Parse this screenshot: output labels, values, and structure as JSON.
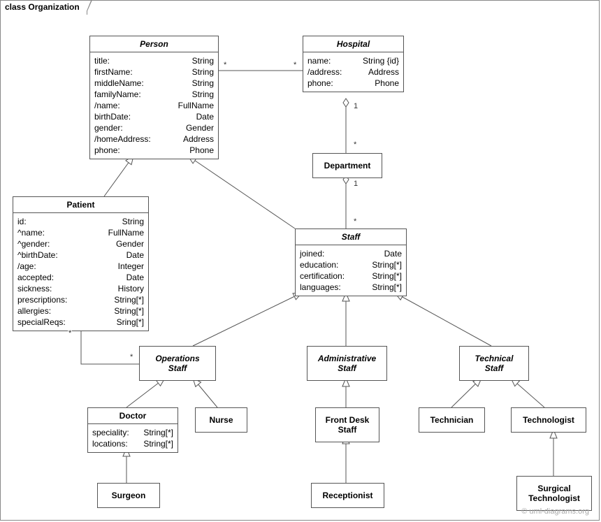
{
  "frame": {
    "title": "class Organization"
  },
  "classes": {
    "person": {
      "title": "Person",
      "attrs": [
        [
          "title:",
          "String"
        ],
        [
          "firstName:",
          "String"
        ],
        [
          "middleName:",
          "String"
        ],
        [
          "familyName:",
          "String"
        ],
        [
          "/name:",
          "FullName"
        ],
        [
          "birthDate:",
          "Date"
        ],
        [
          "gender:",
          "Gender"
        ],
        [
          "/homeAddress:",
          "Address"
        ],
        [
          "phone:",
          "Phone"
        ]
      ]
    },
    "hospital": {
      "title": "Hospital",
      "attrs": [
        [
          "name:",
          "String {id}"
        ],
        [
          "/address:",
          "Address"
        ],
        [
          "phone:",
          "Phone"
        ]
      ]
    },
    "department": {
      "title": "Department"
    },
    "patient": {
      "title": "Patient",
      "attrs": [
        [
          "id:",
          "String"
        ],
        [
          "^name:",
          "FullName"
        ],
        [
          "^gender:",
          "Gender"
        ],
        [
          "^birthDate:",
          "Date"
        ],
        [
          "/age:",
          "Integer"
        ],
        [
          "accepted:",
          "Date"
        ],
        [
          "sickness:",
          "History"
        ],
        [
          "prescriptions:",
          "String[*]"
        ],
        [
          "allergies:",
          "String[*]"
        ],
        [
          "specialReqs:",
          "Sring[*]"
        ]
      ]
    },
    "staff": {
      "title": "Staff",
      "attrs": [
        [
          "joined:",
          "Date"
        ],
        [
          "education:",
          "String[*]"
        ],
        [
          "certification:",
          "String[*]"
        ],
        [
          "languages:",
          "String[*]"
        ]
      ]
    },
    "opsStaff": {
      "title": "Operations\nStaff"
    },
    "adminStaff": {
      "title": "Administrative\nStaff"
    },
    "techStaff": {
      "title": "Technical\nStaff"
    },
    "doctor": {
      "title": "Doctor",
      "attrs": [
        [
          "speciality:",
          "String[*]"
        ],
        [
          "locations:",
          "String[*]"
        ]
      ]
    },
    "nurse": {
      "title": "Nurse"
    },
    "frontDesk": {
      "title": "Front Desk\nStaff"
    },
    "technician": {
      "title": "Technician"
    },
    "technologist": {
      "title": "Technologist"
    },
    "surgeon": {
      "title": "Surgeon"
    },
    "receptionist": {
      "title": "Receptionist"
    },
    "surgTech": {
      "title": "Surgical\nTechnologist"
    }
  },
  "mults": {
    "m1": "*",
    "m2": "*",
    "m3": "1",
    "m4": "*",
    "m5": "1",
    "m6": "*",
    "m7": "*",
    "m8": "*"
  },
  "watermark": "© uml-diagrams.org"
}
